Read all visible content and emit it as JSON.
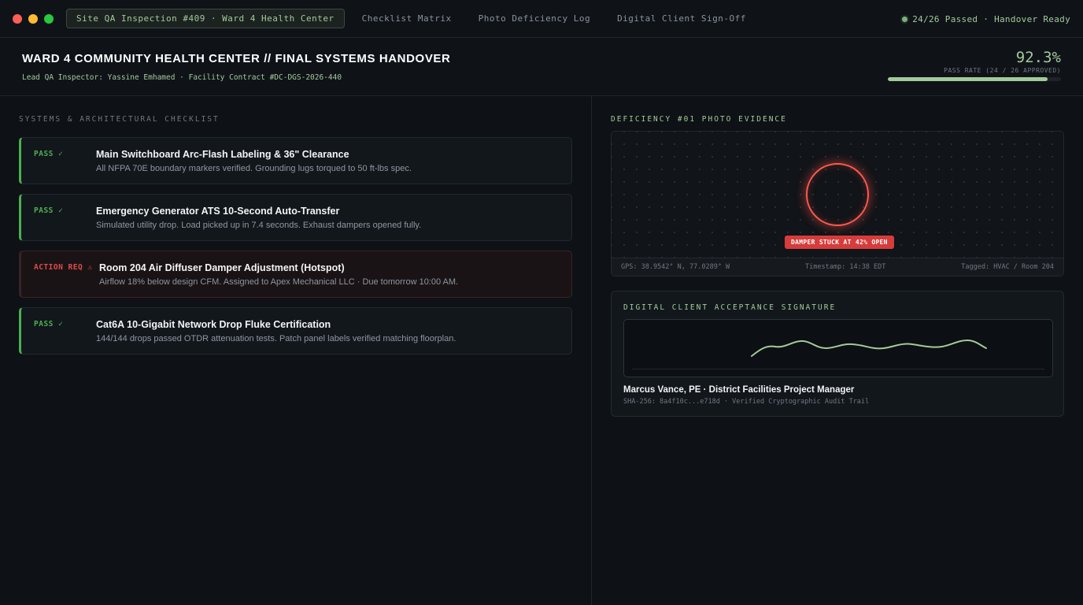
{
  "window": {
    "tabs": [
      {
        "label": "Site QA Inspection #409 · Ward 4 Health Center",
        "active": true
      },
      {
        "label": "Checklist Matrix",
        "active": false
      },
      {
        "label": "Photo Deficiency Log",
        "active": false
      },
      {
        "label": "Digital Client Sign-Off",
        "active": false
      }
    ],
    "status": "24/26 Passed · Handover Ready"
  },
  "header": {
    "title": "WARD 4 COMMUNITY HEALTH CENTER // FINAL SYSTEMS HANDOVER",
    "subtitle": "Lead QA Inspector: Yassine Emhamed · Facility Contract #DC-DGS-2026-440",
    "pass_rate": "92.3%",
    "pass_rate_label": "PASS RATE (24 / 26 APPROVED)",
    "pass_rate_fraction": 0.923
  },
  "checklist": {
    "title": "SYSTEMS & ARCHITECTURAL CHECKLIST",
    "items": [
      {
        "status": "PASS ✓",
        "result": "pass",
        "title": "Main Switchboard Arc-Flash Labeling & 36\" Clearance",
        "desc": "All NFPA 70E boundary markers verified. Grounding lugs torqued to 50 ft-lbs spec."
      },
      {
        "status": "PASS ✓",
        "result": "pass",
        "title": "Emergency Generator ATS 10-Second Auto-Transfer",
        "desc": "Simulated utility drop. Load picked up in 7.4 seconds. Exhaust dampers opened fully."
      },
      {
        "status": "ACTION REQ ⚠",
        "result": "fail",
        "title": "Room 204 Air Diffuser Damper Adjustment (Hotspot)",
        "desc": "Airflow 18% below design CFM. Assigned to Apex Mechanical LLC · Due tomorrow 10:00 AM."
      },
      {
        "status": "PASS ✓",
        "result": "pass",
        "title": "Cat6A 10-Gigabit Network Drop Fluke Certification",
        "desc": "144/144 drops passed OTDR attenuation tests. Patch panel labels verified matching floorplan."
      }
    ]
  },
  "photo": {
    "title": "DEFICIENCY #01 PHOTO EVIDENCE",
    "badge": "DAMPER STUCK AT 42% OPEN",
    "gps": "GPS: 38.9542° N, 77.0289° W",
    "timestamp": "Timestamp: 14:38 EDT",
    "tagged": "Tagged: HVAC / Room 204"
  },
  "signature": {
    "title": "DIGITAL CLIENT ACCEPTANCE SIGNATURE",
    "name": "Marcus Vance, PE · District Facilities Project Manager",
    "hash": "SHA-256: 8a4f10c...e718d · Verified Cryptographic Audit Trail"
  },
  "colors": {
    "accent": "#a3c99a",
    "pass": "#4caf50",
    "fail": "#e14a4a"
  }
}
